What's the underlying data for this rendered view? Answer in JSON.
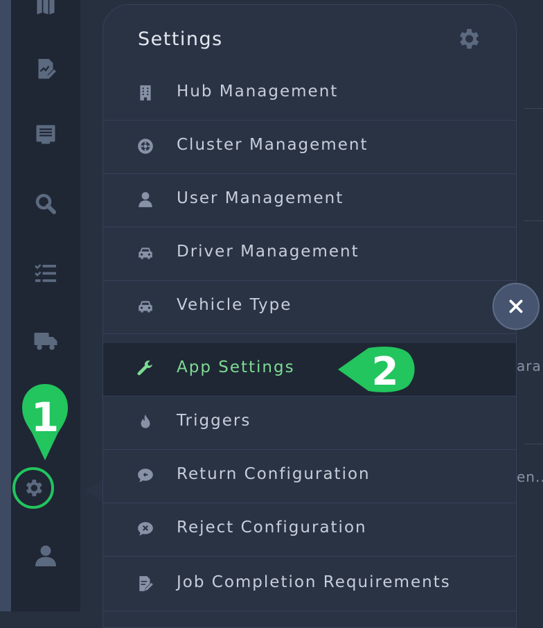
{
  "sidebar": {
    "icons": [
      "map-icon",
      "report-edit-icon",
      "receipt-icon",
      "search-icon",
      "checklist-icon",
      "truck-icon",
      "settings-gear-icon",
      "user-icon"
    ]
  },
  "background": {
    "row1_text": "ara",
    "row2_text": "en..."
  },
  "settings_panel": {
    "title": "Settings",
    "items": [
      {
        "label": "Hub Management",
        "icon": "building-icon"
      },
      {
        "label": "Cluster Management",
        "icon": "cluster-icon"
      },
      {
        "label": "User Management",
        "icon": "user-icon"
      },
      {
        "label": "Driver Management",
        "icon": "car-icon"
      },
      {
        "label": "Vehicle Type",
        "icon": "car-icon"
      },
      {
        "label": "App Settings",
        "icon": "wrench-icon",
        "active": true
      },
      {
        "label": "Triggers",
        "icon": "fire-icon"
      },
      {
        "label": "Return Configuration",
        "icon": "return-bubble-icon"
      },
      {
        "label": "Reject Configuration",
        "icon": "reject-bubble-icon"
      },
      {
        "label": "Job Completion Requirements",
        "icon": "doc-edit-icon"
      }
    ]
  },
  "callouts": {
    "step1": "1",
    "step2": "2"
  },
  "colors": {
    "accent_green": "#22c55e",
    "active_text": "#7ddc92",
    "panel_bg": "#2a3344",
    "sidebar_bg": "#1f2634"
  }
}
